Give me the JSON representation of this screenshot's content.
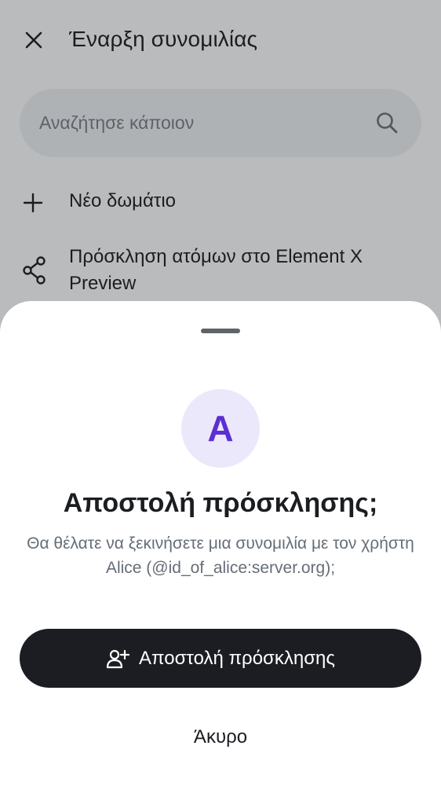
{
  "header": {
    "title": "Έναρξη συνομιλίας",
    "close_icon": "close-icon"
  },
  "search": {
    "placeholder": "Αναζήτησε κάποιον",
    "icon": "search-icon"
  },
  "actions": [
    {
      "label": "Νέο δωμάτιο",
      "icon": "plus-icon"
    },
    {
      "label": "Πρόσκληση ατόμων στο Element X Preview",
      "icon": "share-icon"
    }
  ],
  "sheet": {
    "avatar_letter": "A",
    "title": "Αποστολή πρόσκλησης;",
    "body": "Θα θέλατε να ξεκινήσετε μια συνομιλία με τον χρήστη Alice (@id_of_alice:server.org);",
    "primary_label": "Αποστολή πρόσκλησης",
    "primary_icon": "add-user-icon",
    "cancel_label": "Άκυρο"
  },
  "colors": {
    "scrim": "#1b1d22",
    "avatar_bg": "#ece8fb",
    "avatar_fg": "#5b2fd1",
    "button_bg": "#1b1d22"
  }
}
